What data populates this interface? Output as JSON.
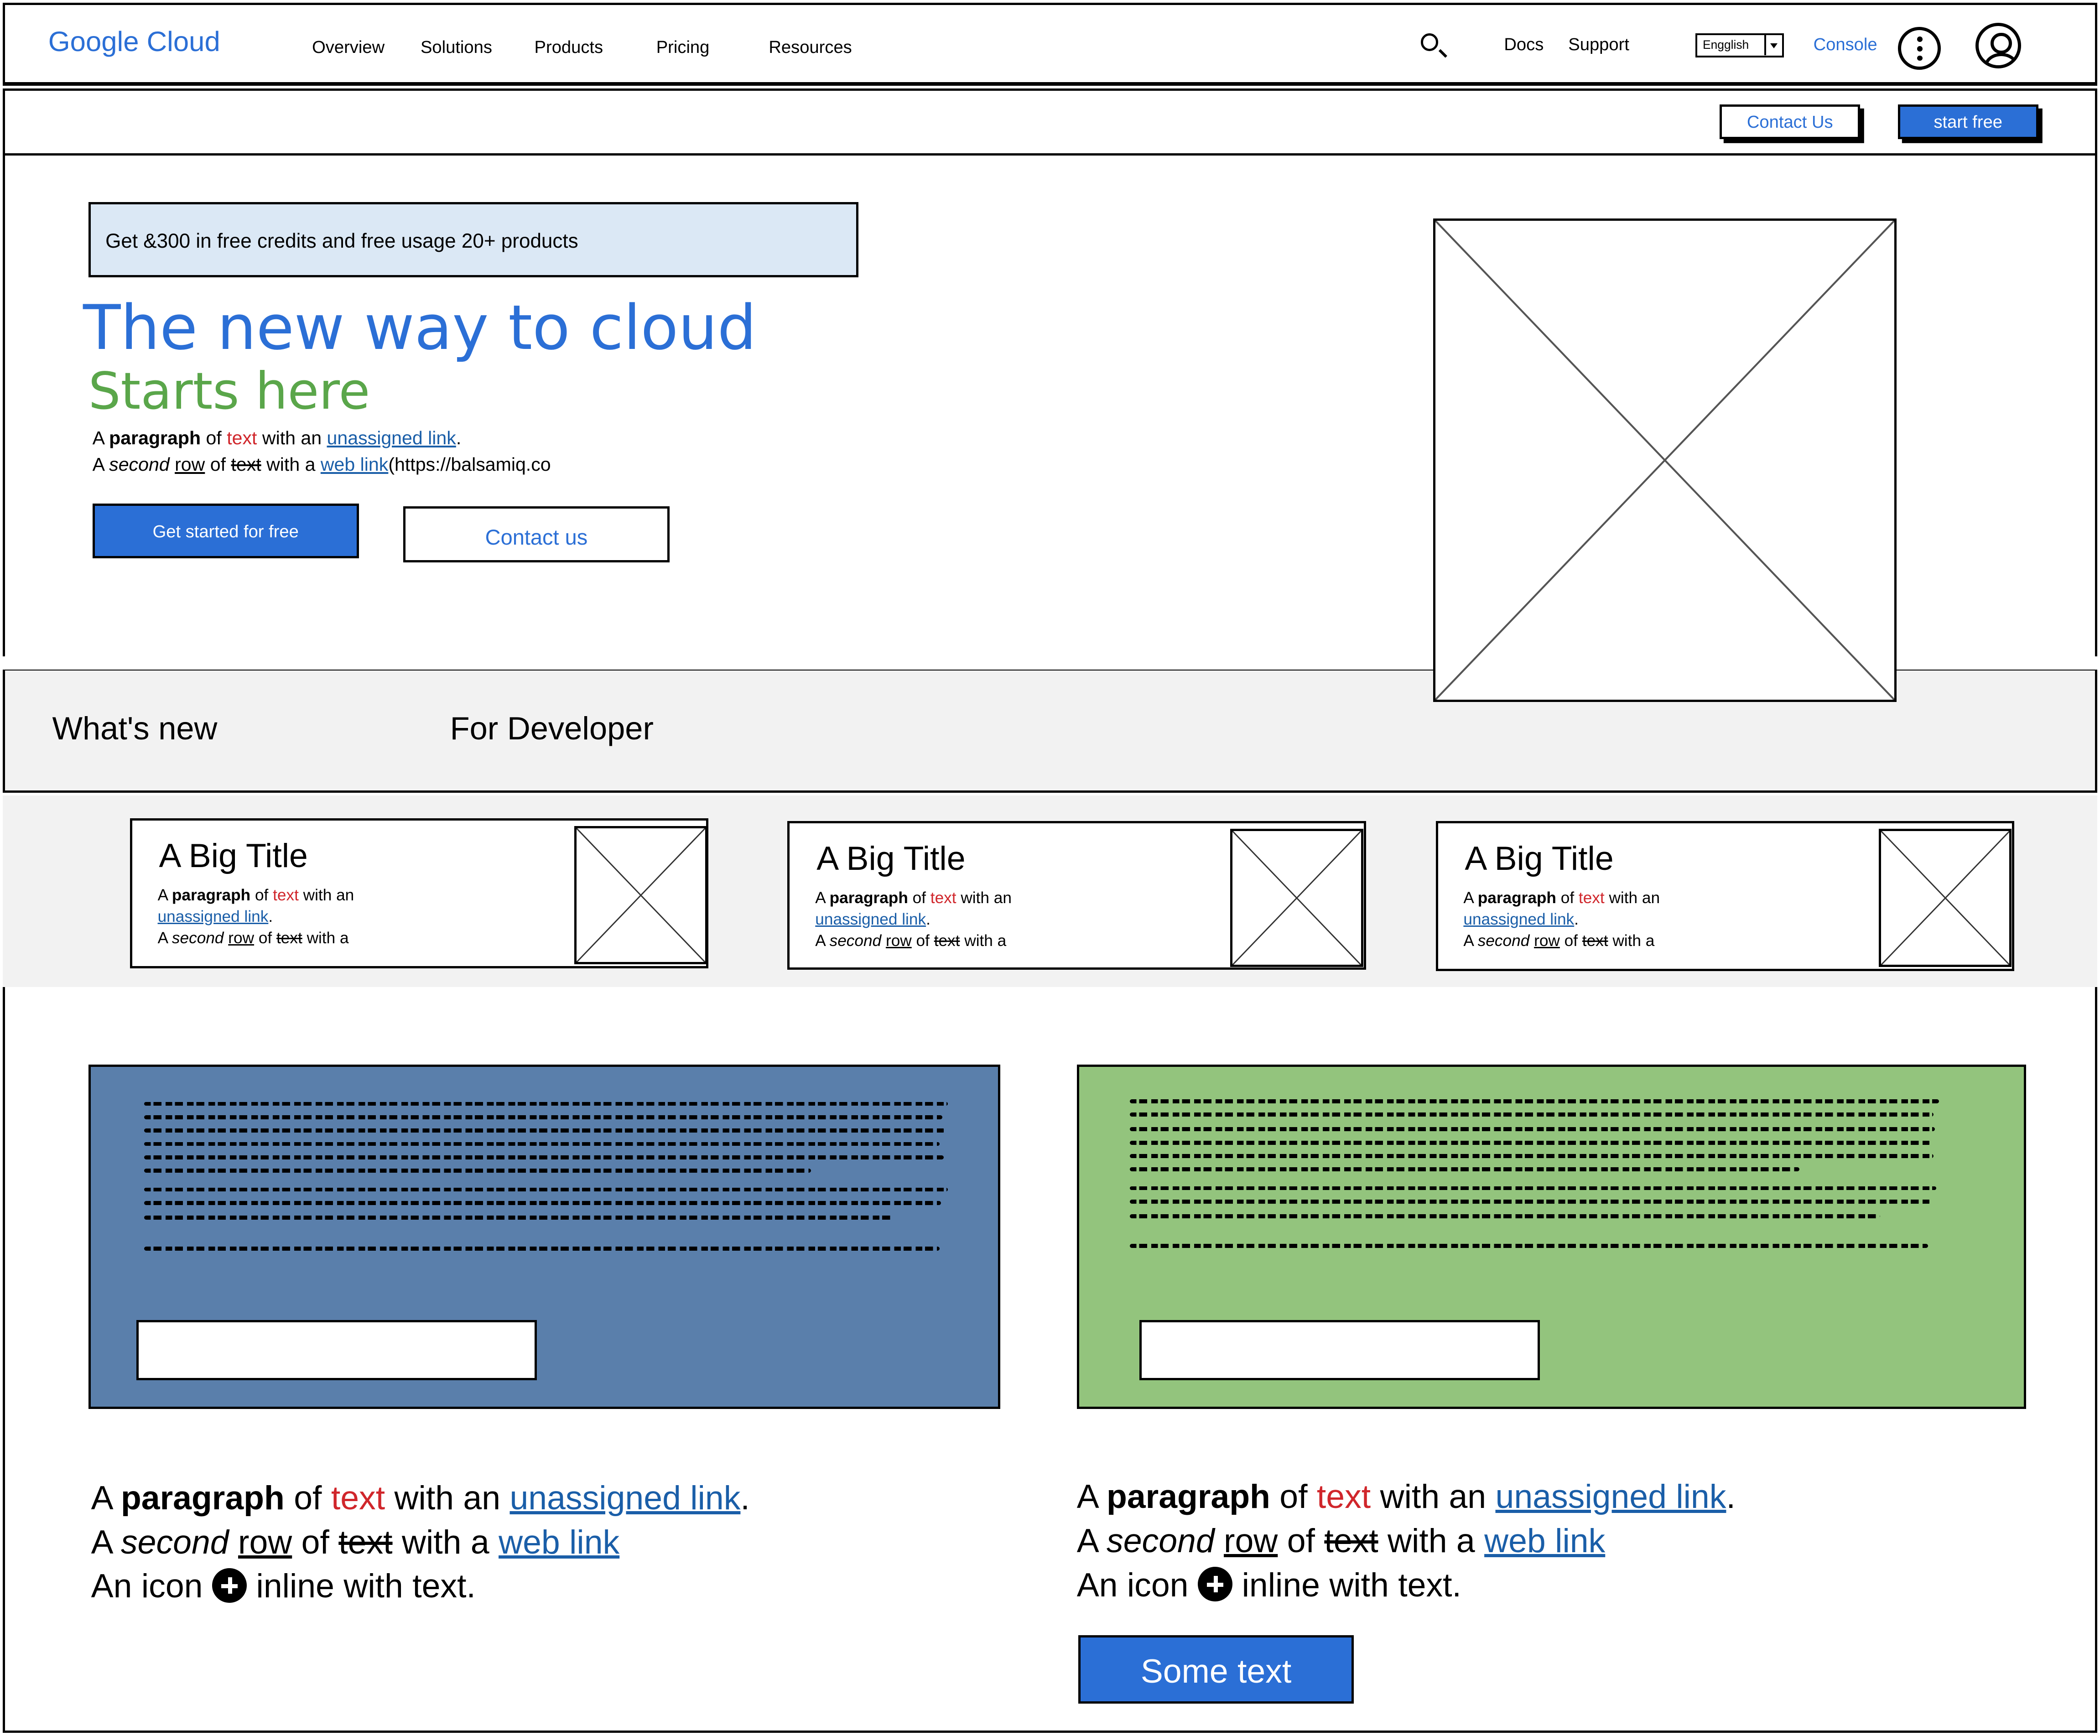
{
  "header": {
    "logo": "Google Cloud",
    "nav": [
      "Overview",
      "Solutions",
      "Products",
      "Pricing",
      "Resources"
    ],
    "docs": "Docs",
    "support": "Support",
    "language": "Engglish",
    "console": "Console"
  },
  "subbar": {
    "contact_label": "Contact Us",
    "start_label": "start free"
  },
  "hero": {
    "promo": "Get &300 in free credits and free usage 20+ products",
    "title": "The new way to cloud",
    "subtitle": "Starts here",
    "para": {
      "r1_a": "A ",
      "r1_bold": "paragraph",
      "r1_of": " of ",
      "r1_red": "text",
      "r1_with": " with an ",
      "r1_link": "unassigned link",
      "r1_end": ".",
      "r2_a": "A ",
      "r2_italic": "second",
      "r2_sp": " ",
      "r2_under": "row",
      "r2_of": " of ",
      "r2_strike": "text",
      "r2_with": " with a ",
      "r2_link": "web link",
      "r2_tail": "(https://balsamiq.co"
    },
    "primary_button": "Get started for free",
    "secondary_button": "Contact us"
  },
  "tabs": [
    "What's new",
    "For Developer"
  ],
  "cards": [
    {
      "title": "A Big Title"
    },
    {
      "title": "A Big Title"
    },
    {
      "title": "A Big Title"
    }
  ],
  "card_text": {
    "a": "A ",
    "bold": "paragraph",
    "of": " of ",
    "red": "text",
    "with": " with an",
    "link": "unassigned link",
    "end": ".",
    "r3_a": "A ",
    "r3_italic": "second",
    "r3_sp": " ",
    "r3_under": "row",
    "r3_of": " of ",
    "r3_strike": "text",
    "r3_with": " with a"
  },
  "panels": {
    "left_color": "#5a7fab",
    "right_color": "#93c47d"
  },
  "bottom_text": {
    "a": "A ",
    "bold": "paragraph",
    "of": " of ",
    "red": "text",
    "with": " with an ",
    "link": "unassigned link",
    "end": ".",
    "r2_a": "A ",
    "r2_italic": "second",
    "r2_sp": " ",
    "r2_under": "row",
    "r2_of": " of ",
    "r2_strike": "text",
    "r2_with": " with a ",
    "r2_link": "web link",
    "r3_before": "An icon ",
    "r3_after": " inline with text."
  },
  "bottom_button": "Some text",
  "colors": {
    "accent_blue": "#2b6fd6",
    "green": "#5aa64a",
    "red_text": "#d0262b",
    "link": "#1a5ea8",
    "promo_bg": "#dbe8f5",
    "band_bg": "#f2f2f2"
  },
  "icons": [
    "search-icon",
    "dropdown-arrow-icon",
    "more-vertical-icon",
    "user-account-icon",
    "plus-circle-icon",
    "image-placeholder-icon"
  ]
}
